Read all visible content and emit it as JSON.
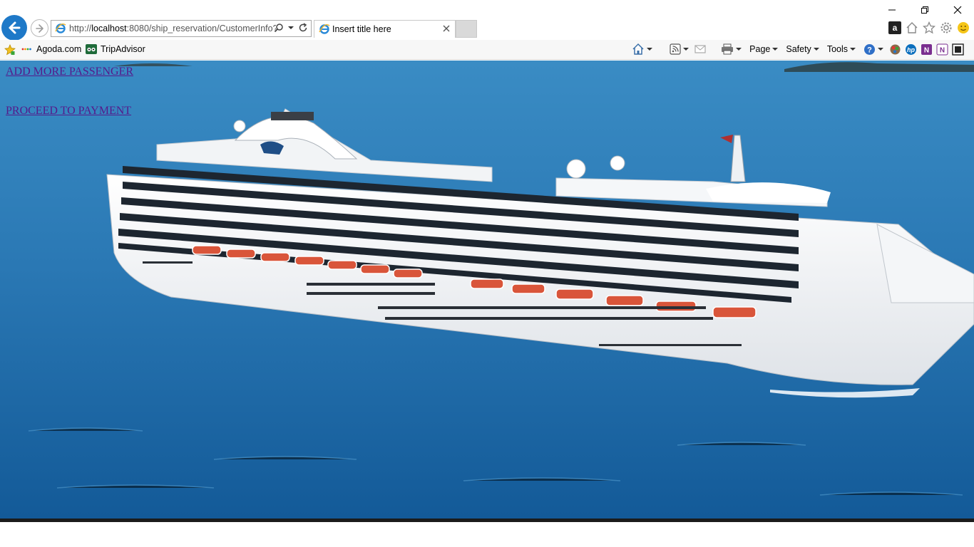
{
  "browser": {
    "address_url_prefix": "http://",
    "address_url_host": "localhost",
    "address_url_rest": ":8080/ship_reservation/CustomerInfo?I",
    "tab_title": "Insert title here",
    "favorites": [
      {
        "label": "Agoda.com",
        "icon": "agoda-icon"
      },
      {
        "label": "TripAdvisor",
        "icon": "tripadvisor-icon"
      }
    ],
    "menus": {
      "page": "Page",
      "safety": "Safety",
      "tools": "Tools"
    },
    "accent_color": "#1e79c8"
  },
  "page": {
    "link_add_passenger": "ADD MORE PASSENGER",
    "link_proceed_payment": "PROCEED TO PAYMENT",
    "link_color": "#551a8b",
    "background_image": "cruise-ship-at-sea"
  }
}
